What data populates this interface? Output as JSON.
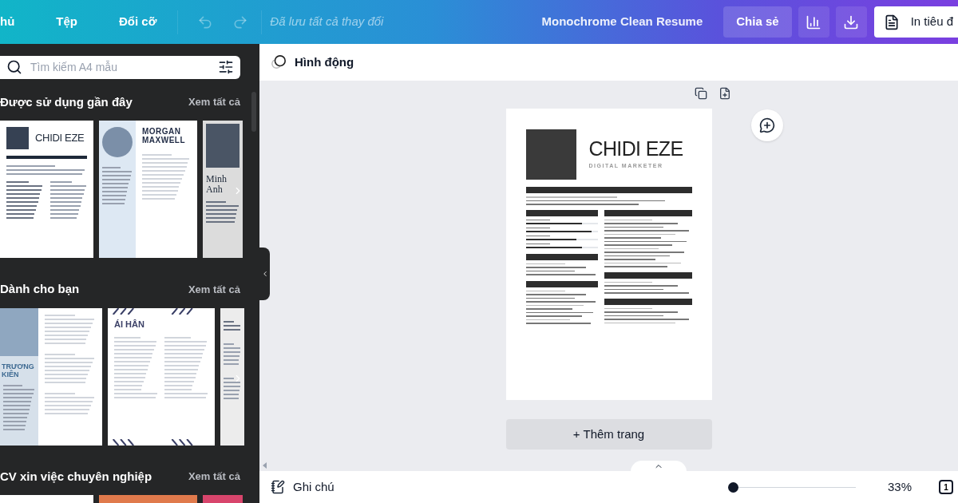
{
  "topbar": {
    "menu": [
      {
        "label": "hủ"
      },
      {
        "label": "Tệp"
      },
      {
        "label": "Đổi cỡ"
      }
    ],
    "undo": {
      "disabled": true
    },
    "redo": {
      "disabled": true
    },
    "status": "Đã lưu tất cả thay đổi",
    "document_title": "Monochrome Clean Resume",
    "share_label": "Chia sẻ",
    "print_label": "In tiêu đ"
  },
  "sidebar": {
    "search": {
      "placeholder": "Tìm kiếm A4 mẫu"
    },
    "sections": [
      {
        "title": "Được sử dụng gần đây",
        "link": "Xem tất cả",
        "templates": [
          {
            "kind": "mono",
            "headline": "CHIDI EZE"
          },
          {
            "kind": "blue",
            "headline": "MORGAN MAXWELL"
          },
          {
            "kind": "dark",
            "headline": "Minh Anh"
          }
        ]
      },
      {
        "title": "Dành cho bạn",
        "link": "Xem tất cả",
        "templates": [
          {
            "kind": "sidebar",
            "headline": "TRƯƠNG KIÊN"
          },
          {
            "kind": "pattern",
            "headline": "ÁI HÂN"
          },
          {
            "kind": "plain"
          }
        ]
      },
      {
        "title": "CV xin việc chuyên nghiệp",
        "link": "Xem tất cả",
        "templates": [
          {
            "kind": "strip",
            "color": "#ffffff"
          },
          {
            "kind": "strip",
            "color": "#e07a4c"
          },
          {
            "kind": "strip",
            "color": "#d8456c"
          }
        ]
      }
    ]
  },
  "toolbar": {
    "animate_label": "Hình động"
  },
  "page": {
    "name": "CHIDI EZE",
    "role": "DIGITAL MARKETER",
    "skills": [
      {
        "level": 0.78
      },
      {
        "level": 0.92
      },
      {
        "level": 0.7
      },
      {
        "level": 0.78
      }
    ]
  },
  "add_page_label": "+ Thêm trang",
  "footer": {
    "notes_label": "Ghi chú",
    "zoom": {
      "level": 0.0
    },
    "zoom_reading": "33%",
    "page_count": "1"
  }
}
